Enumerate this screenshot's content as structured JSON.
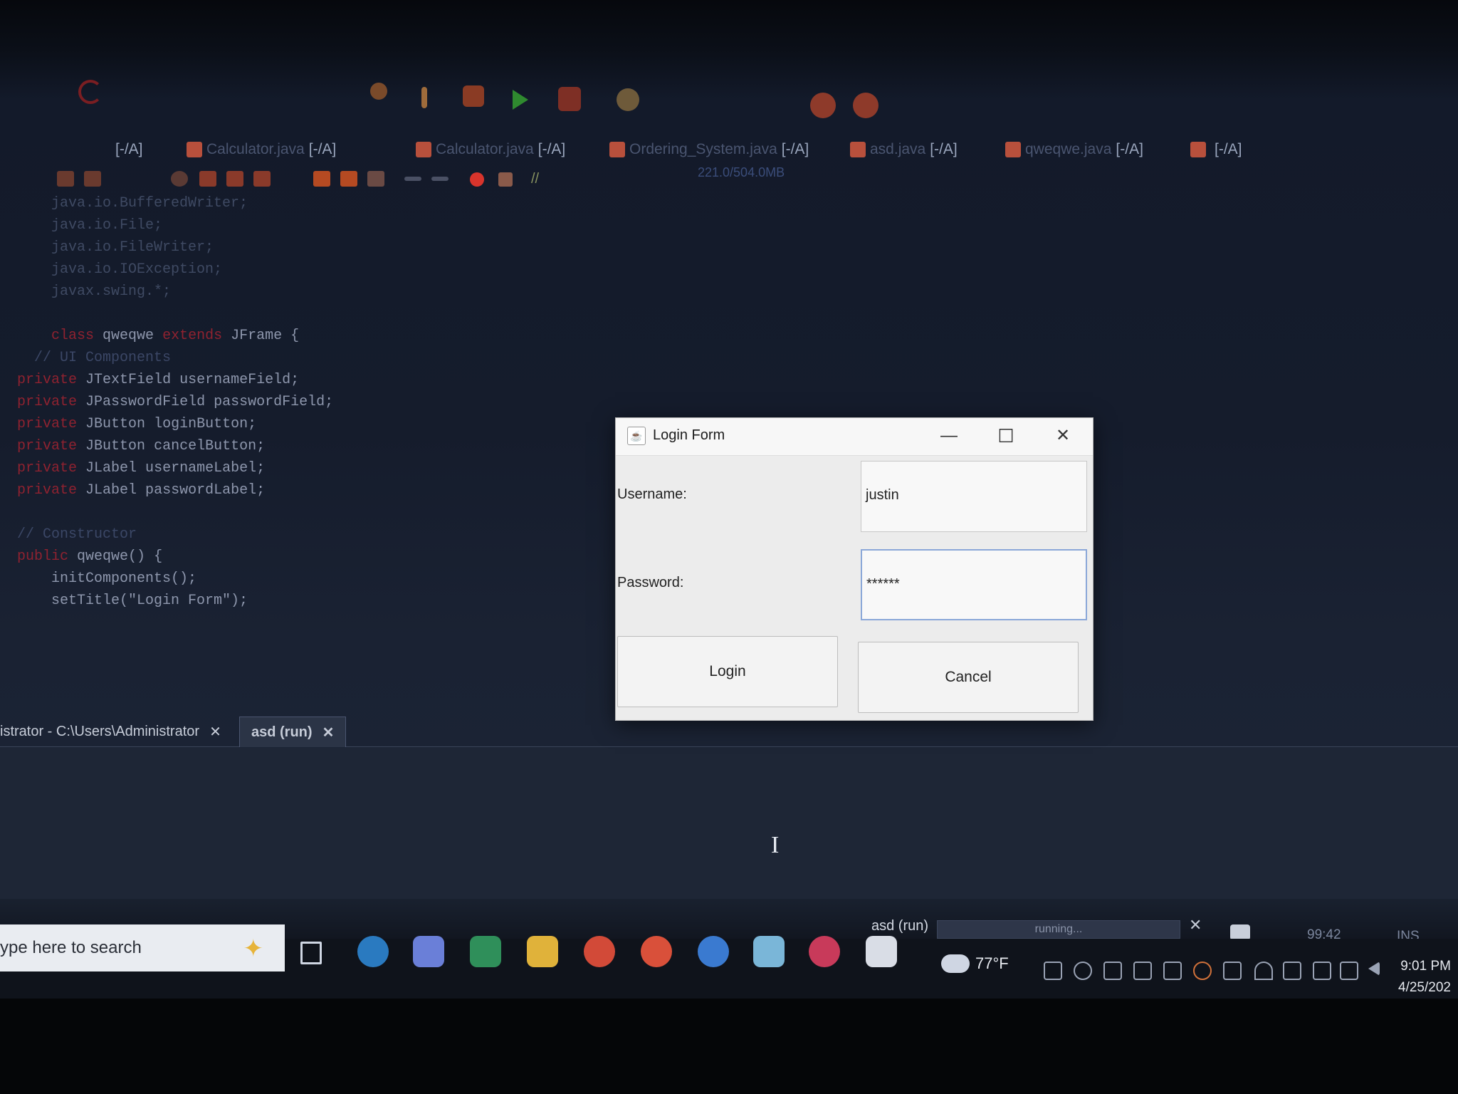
{
  "ide": {
    "memory_indicator": "221.0/504.0MB",
    "file_tabs": [
      {
        "name": "",
        "suffix": "[-/A]"
      },
      {
        "name": "Calculator.java",
        "suffix": "[-/A]"
      },
      {
        "name": "Calculator.java",
        "suffix": "[-/A]"
      },
      {
        "name": "Ordering_System.java",
        "suffix": "[-/A]"
      },
      {
        "name": "asd.java",
        "suffix": "[-/A]"
      },
      {
        "name": "qweqwe.java",
        "suffix": "[-/A]"
      },
      {
        "name": "",
        "suffix": "[-/A]"
      }
    ],
    "code": {
      "l0": "java.io.BufferedWriter;",
      "l1": "java.io.File;",
      "l2": "java.io.FileWriter;",
      "l3": "java.io.IOException;",
      "l4": "javax.swing.*;",
      "class_kw": "class",
      "class_name": "qweqwe",
      "extends_kw": "extends",
      "class_tail": "JFrame {",
      "comment_ui": "// UI Components",
      "private_kw": "private",
      "f0": "JTextField usernameField;",
      "f1": "JPasswordField passwordField;",
      "f2": "JButton loginButton;",
      "f3": "JButton cancelButton;",
      "f4": "JLabel usernameLabel;",
      "f5": "JLabel passwordLabel;",
      "comment_ctor": "// Constructor",
      "public_kw": "public",
      "ctor": "qweqwe() {",
      "init": "initComponents();",
      "settitle": "setTitle(\"Login Form\");"
    },
    "output_tabs": [
      {
        "label": "istrator - C:\\Users\\Administrator",
        "close": "✕"
      },
      {
        "label": "asd (run)",
        "close": "✕"
      }
    ],
    "status": {
      "run_label": "asd (run)",
      "progress_text": "running...",
      "progress_close": "✕",
      "position": "99:42",
      "mode": "INS"
    }
  },
  "dialog": {
    "title": "Login Form",
    "minimize": "—",
    "maximize": "☐",
    "close": "✕",
    "username_label": "Username:",
    "username_value": "justin",
    "password_label": "Password:",
    "password_value": "******",
    "login_button": "Login",
    "cancel_button": "Cancel"
  },
  "taskbar": {
    "search_placeholder": "ype here to search",
    "weather": "77°F",
    "time": "9:01 PM",
    "date": "4/25/202"
  },
  "colors": {
    "accent_run": "#3aa43a",
    "keyword": "#8f2230",
    "stop": "#d8342c"
  }
}
